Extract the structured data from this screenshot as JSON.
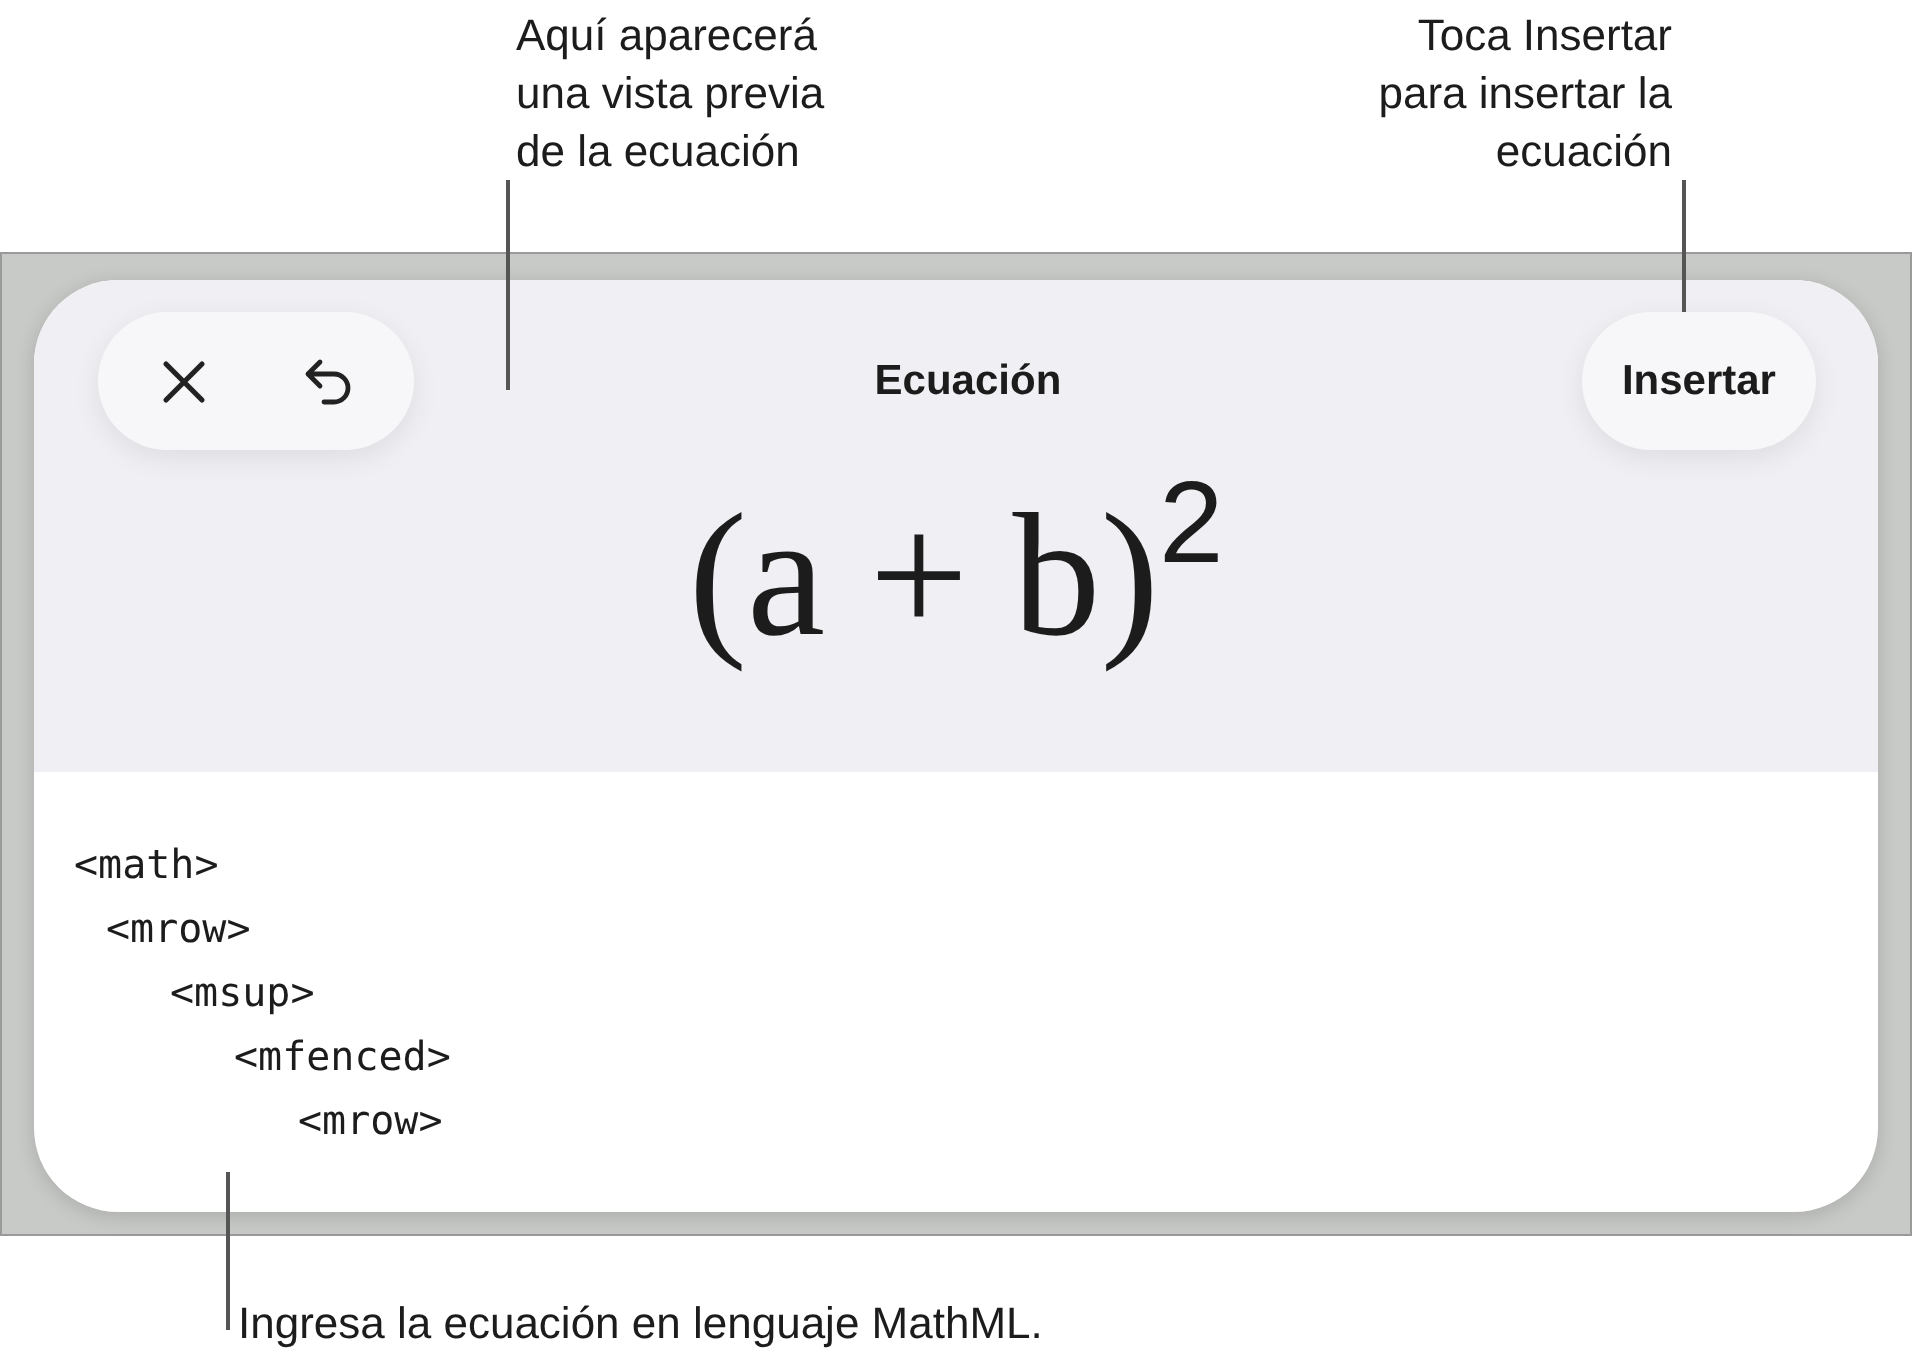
{
  "callouts": [
    {
      "kind": "top-center",
      "text": "Aquí aparecerá\nuna vista previa\nde la ecuación"
    },
    {
      "kind": "top-right",
      "text": "Toca Insertar\npara insertar la\necuación"
    },
    {
      "kind": "bottom",
      "text": "Ingresa la ecuación en lenguaje MathML."
    }
  ],
  "dialog": {
    "title": "Ecuación",
    "insert_button": "Insertar",
    "preview": "(a + b)$^{2}$",
    "code": [
      {
        "line": "<math>",
        "children": [
          {
            "line": "<mrow>",
            "children": [
              {
                "line": "<msup>",
                "children": [
                  {
                    "line": "<mfenced>",
                    "children": [
                      {
                        "line": "<mrow>"
                      }
                    ]
                  }
                ]
              }
            ]
          }
        ]
      }
    ]
  }
}
